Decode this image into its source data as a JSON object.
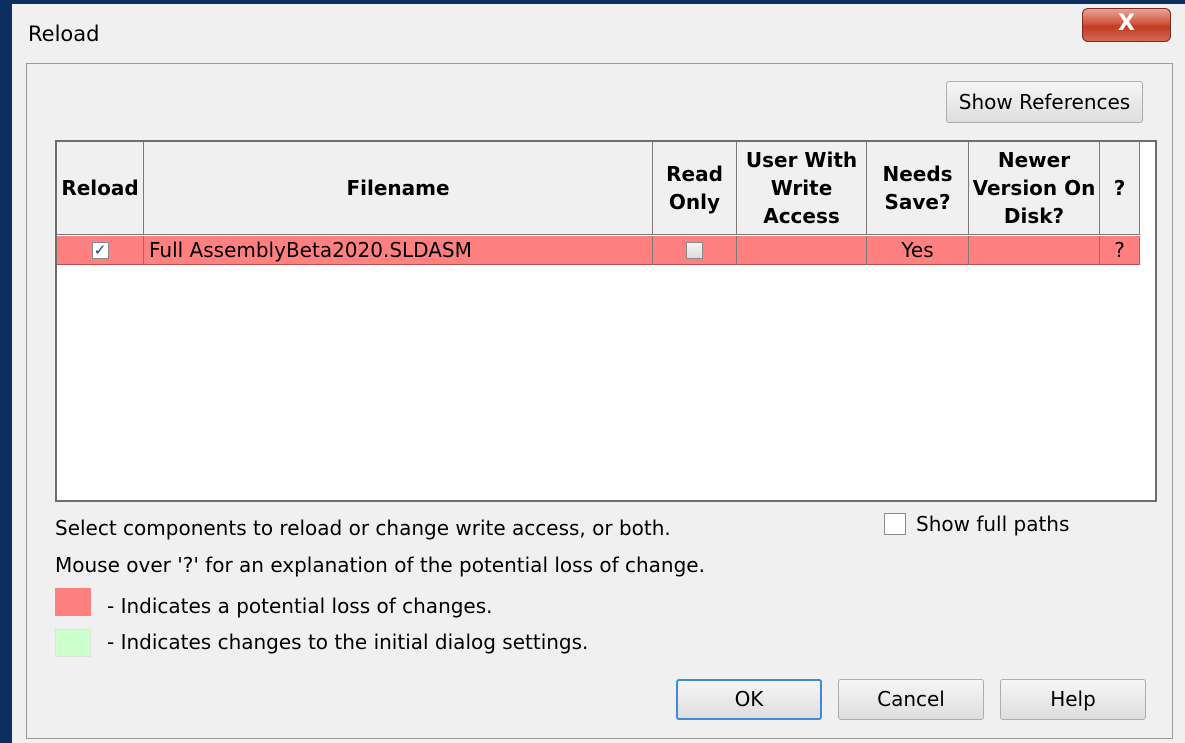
{
  "window": {
    "title": "Reload",
    "close_label": "X"
  },
  "buttons": {
    "show_references": "Show References",
    "ok": "OK",
    "cancel": "Cancel",
    "help": "Help"
  },
  "table": {
    "headers": {
      "reload": "Reload",
      "filename": "Filename",
      "read_only": "Read\nOnly",
      "user_with_write_access": "User With\nWrite\nAccess",
      "needs_save": "Needs\nSave?",
      "newer_version": "Newer\nVersion On\nDisk?",
      "explain": "?"
    },
    "rows": [
      {
        "reload_checked": true,
        "filename": "Full AssemblyBeta2020.SLDASM",
        "read_only_checked": false,
        "user_with_write_access": "",
        "needs_save": "Yes",
        "newer_version": "",
        "explain": "?"
      }
    ]
  },
  "show_full_paths": {
    "label": "Show full paths",
    "checked": false
  },
  "instructions": {
    "line1": "Select components to reload or change write access, or both.",
    "line2": "Mouse over '?' for an explanation of the potential loss of change."
  },
  "legend": [
    {
      "color": "#ff8080",
      "text": "- Indicates a potential loss of changes."
    },
    {
      "color": "#ccffcc",
      "text": "- Indicates changes to the initial dialog settings."
    }
  ],
  "colors": {
    "loss_of_changes": "#ff8080",
    "changed_setting": "#ccffcc",
    "check_mark": "✓"
  }
}
